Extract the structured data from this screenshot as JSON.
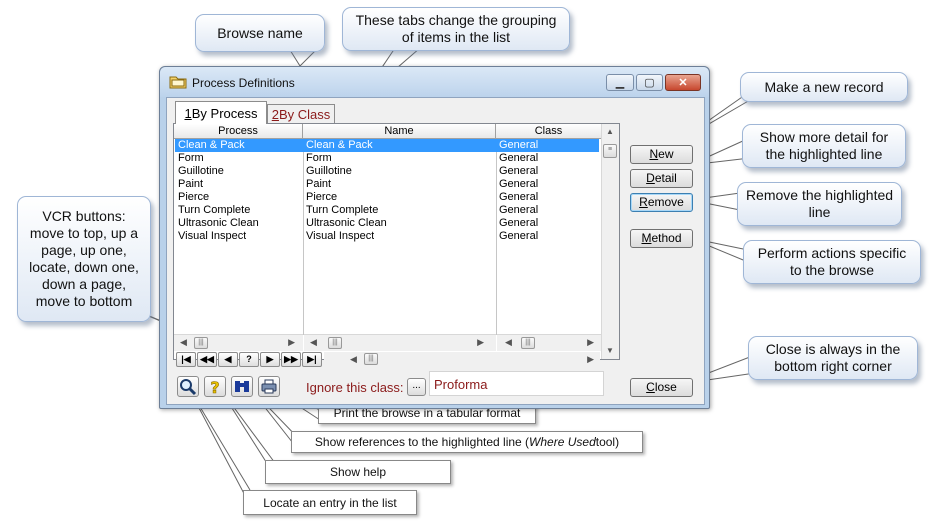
{
  "callouts": {
    "browse_name": "Browse name",
    "tabs_note": "These tabs change the grouping of items in the list",
    "new_record": "Make a new record",
    "more_detail": "Show more detail for the highlighted line",
    "remove_line": "Remove the highlighted line",
    "perform_actions": "Perform actions specific to the  browse",
    "close_corner": "Close is always in the bottom right corner",
    "vcr_buttons": "VCR buttons: move to top, up a page, up one, locate, down one, down a page, move to bottom"
  },
  "notes": {
    "print": "Print the browse in a tabular format",
    "where_used_prefix": "Show references to the highlighted line (",
    "where_used_em": "Where Used",
    "where_used_suffix": " tool)",
    "help": "Show help",
    "locate": "Locate an entry in the list"
  },
  "window": {
    "title": "Process Definitions",
    "tabs": [
      {
        "key": "1",
        "rest": " By Process",
        "active": true
      },
      {
        "key": "2",
        "rest": " By Class",
        "active": false
      }
    ],
    "columns": [
      "Process",
      "Name",
      "Class"
    ],
    "rows": [
      {
        "process": "Clean & Pack",
        "name": "Clean & Pack",
        "class": "General",
        "selected": true
      },
      {
        "process": "Form",
        "name": "Form",
        "class": "General"
      },
      {
        "process": "Guillotine",
        "name": "Guillotine",
        "class": "General"
      },
      {
        "process": "Paint",
        "name": "Paint",
        "class": "General"
      },
      {
        "process": "Pierce",
        "name": "Pierce",
        "class": "General"
      },
      {
        "process": "Turn Complete",
        "name": "Turn Complete",
        "class": "General"
      },
      {
        "process": "Ultrasonic Clean",
        "name": "Ultrasonic Clean",
        "class": "General"
      },
      {
        "process": "Visual Inspect",
        "name": "Visual Inspect",
        "class": "General"
      }
    ],
    "buttons": {
      "new": {
        "key": "N",
        "rest": "ew"
      },
      "detail": {
        "key": "D",
        "rest": "etail"
      },
      "remove": {
        "key": "R",
        "rest": "emove"
      },
      "method": {
        "key": "M",
        "rest": "ethod"
      },
      "close": {
        "key": "C",
        "rest": "lose"
      }
    },
    "vcr": [
      "|◀",
      "◀◀",
      "◀",
      "?",
      "▶",
      "▶▶",
      "▶|"
    ],
    "ignore_label": "Ignore this class:",
    "ignore_button": "...",
    "ignore_value": "Proforma",
    "icons": [
      "magnifier-icon",
      "help-icon",
      "binoculars-icon",
      "printer-icon"
    ]
  },
  "colors": {
    "selection": "#3399ff",
    "accent_red": "#8b1a1a",
    "callout_border": "#9fb6d6"
  }
}
